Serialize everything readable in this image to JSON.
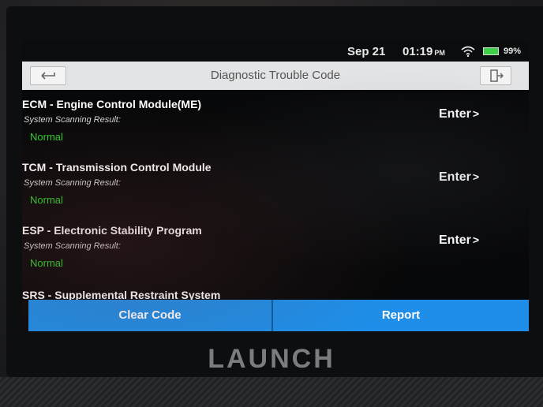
{
  "status_bar": {
    "date": "Sep 21",
    "time": "01:19",
    "ampm": "PM",
    "battery": "99%",
    "battery_color": "#3fd04a"
  },
  "header": {
    "title": "Diagnostic Trouble Code",
    "back_icon": "back-arrow-icon",
    "exit_icon": "exit-icon"
  },
  "modules": [
    {
      "title": "ECM - Engine Control Module(ME)",
      "subtitle": "System Scanning Result:",
      "status": "Normal",
      "action": "Enter"
    },
    {
      "title": "TCM - Transmission Control Module",
      "subtitle": "System Scanning Result:",
      "status": "Normal",
      "action": "Enter"
    },
    {
      "title": "ESP - Electronic Stability Program",
      "subtitle": "System Scanning Result:",
      "status": "Normal",
      "action": "Enter"
    },
    {
      "title": "SRS - Supplemental Restraint System"
    }
  ],
  "actions": {
    "clear_code": "Clear Code",
    "report": "Report"
  },
  "device": {
    "brand": "LAUNCH"
  },
  "colors": {
    "accent": "#1e8ee8",
    "status_normal": "#2fd12f"
  }
}
